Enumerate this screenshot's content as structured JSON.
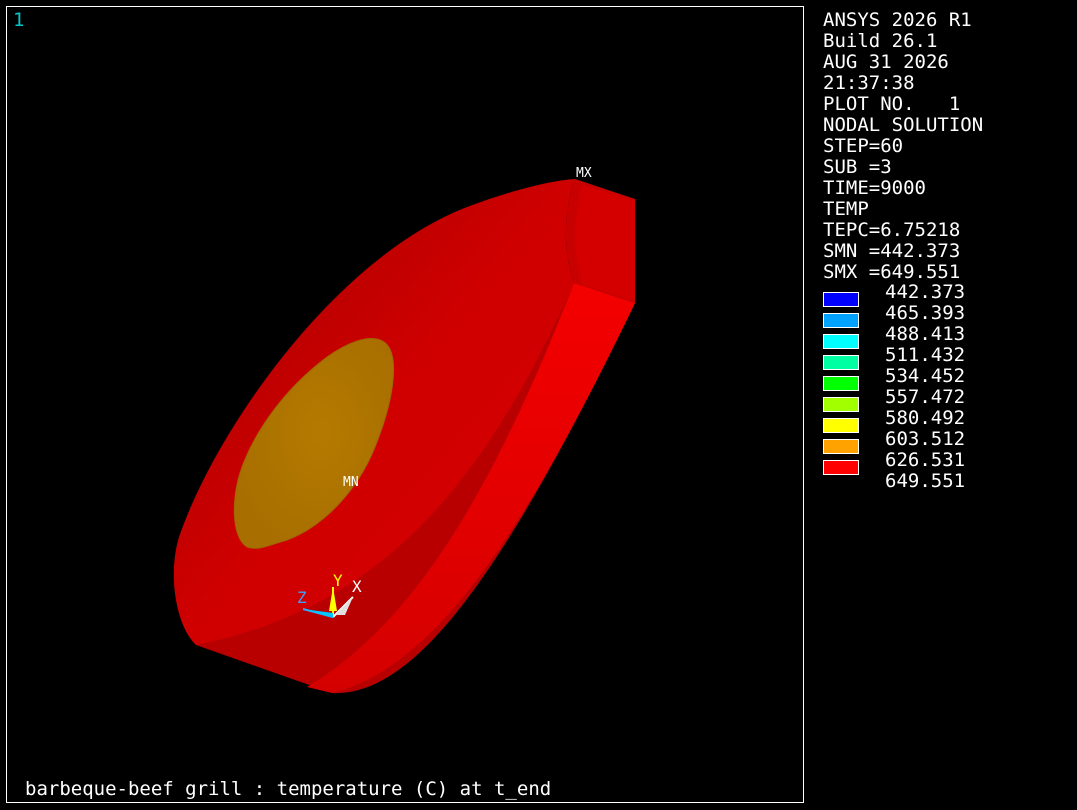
{
  "window": {
    "number": "1"
  },
  "caption": "barbeque-beef grill : temperature (C) at t_end",
  "markers": {
    "max": "MX",
    "min": "MN"
  },
  "triad": {
    "x": "X",
    "y": "Y",
    "z": "Z"
  },
  "info_lines": [
    "ANSYS 2026 R1",
    "Build 26.1",
    "AUG 31 2026",
    "21:37:38",
    "PLOT NO.   1",
    "NODAL SOLUTION",
    "STEP=60",
    "SUB =3",
    "TIME=9000",
    "TEMP",
    "TEPC=6.75218",
    "SMN =442.373",
    "SMX =649.551"
  ],
  "legend": {
    "values": [
      "442.373",
      "465.393",
      "488.413",
      "511.432",
      "534.452",
      "557.472",
      "580.492",
      "603.512",
      "626.531",
      "649.551"
    ],
    "colors": [
      "#0000ff",
      "#00a2ff",
      "#00ffff",
      "#00ffa2",
      "#00ff00",
      "#a2ff00",
      "#ffff00",
      "#ffa200",
      "#ff0000"
    ]
  },
  "model_colors": {
    "front_face": "#cc0000",
    "side_face": "#ee0000",
    "top_cap": "#b80000",
    "core": "#b47800",
    "core_edge": "#9a6400"
  }
}
